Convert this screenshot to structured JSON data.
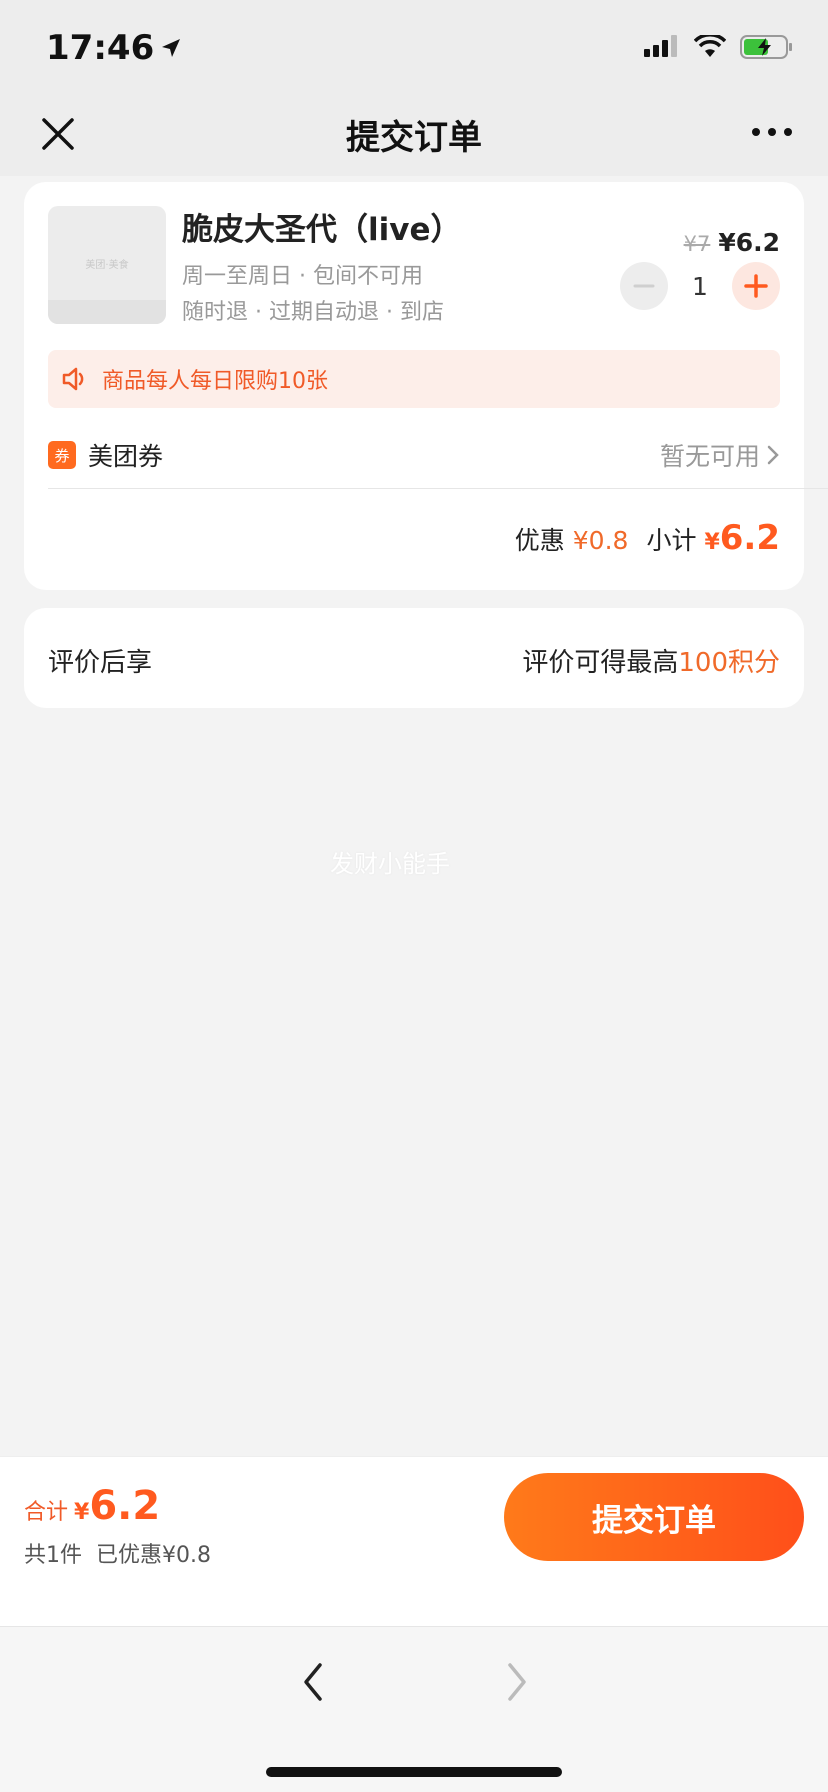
{
  "status_bar": {
    "time": "17:46"
  },
  "nav": {
    "title": "提交订单"
  },
  "product": {
    "name": "脆皮大圣代（live）",
    "meta_line1": "周一至周日 · 包间不可用",
    "meta_line2": "随时退 · 过期自动退 · 到店",
    "thumb_text": "美团·美食",
    "original_price": "¥7",
    "current_price": "¥6.2",
    "quantity": "1",
    "purchase_limit": "商品每人每日限购10张"
  },
  "coupon": {
    "badge": "券",
    "label": "美团券",
    "status": "暂无可用"
  },
  "subtotal": {
    "discount_label": "优惠",
    "discount_value": "¥0.8",
    "label": "小计",
    "yen": "¥",
    "amount": "6.2"
  },
  "review": {
    "label": "评价后享",
    "text": "评价可得最高",
    "highlight": "100积分"
  },
  "watermark": "发财小能手",
  "submit_bar": {
    "total_label": "合计",
    "total_yen": "¥",
    "total_amount": "6.2",
    "item_count": "共1件",
    "saved": "已优惠¥0.8",
    "submit_label": "提交订单"
  },
  "colors": {
    "accent": "#ff5a1f",
    "banner_bg": "#fdeee9",
    "page_bg": "#f3f3f3"
  },
  "icons": [
    "location-arrow-icon",
    "signal-icon",
    "wifi-icon",
    "battery-charging-icon",
    "close-icon",
    "more-icon",
    "speaker-icon",
    "chevron-right-icon",
    "back-icon",
    "forward-icon"
  ]
}
